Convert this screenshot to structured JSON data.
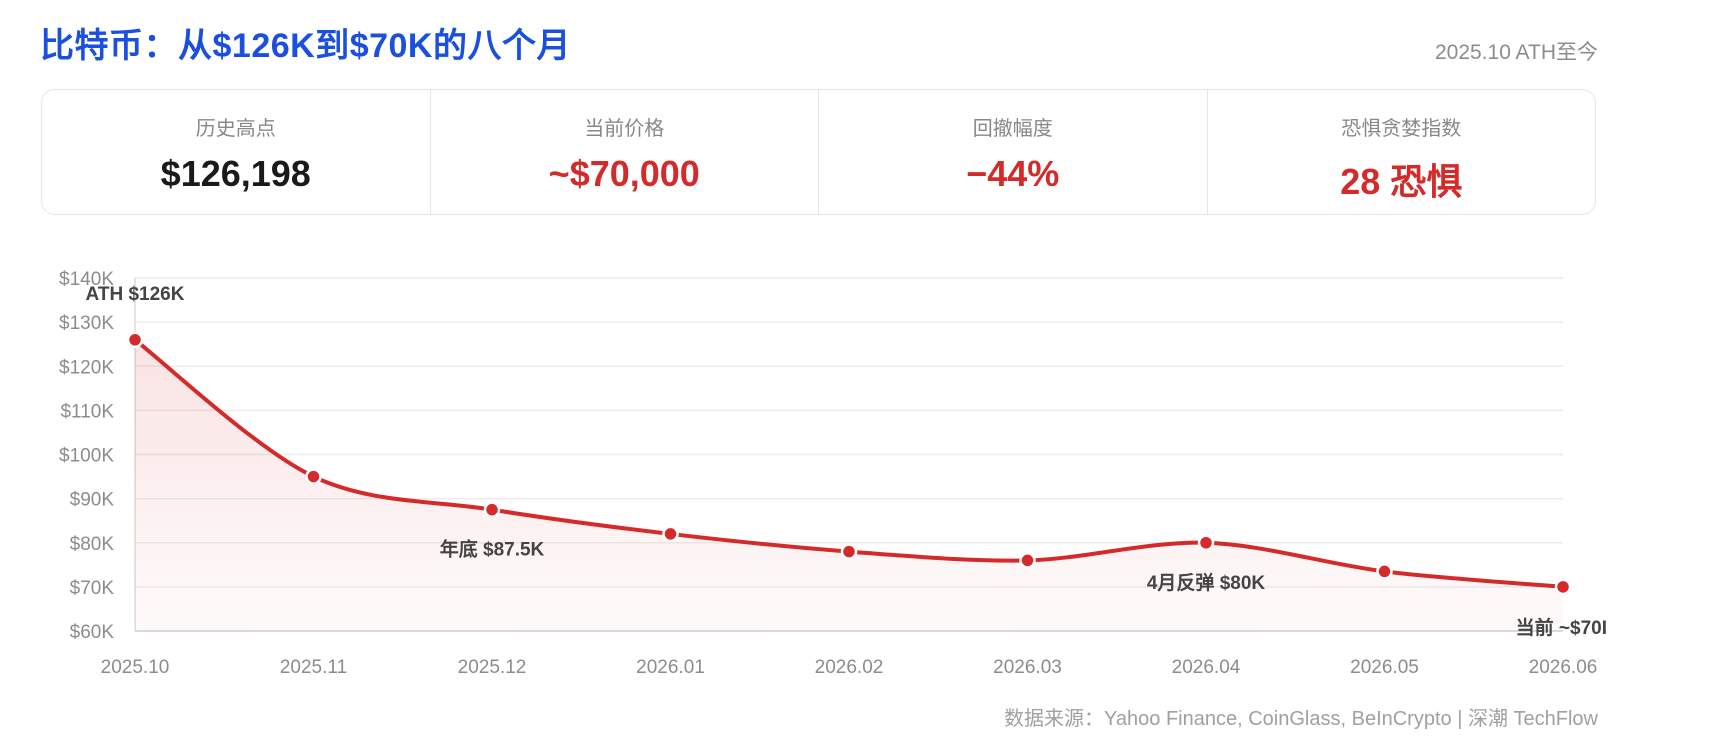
{
  "header": {
    "title": "比特币：从$126K到$70K的八个月",
    "date_range": "2025.10 ATH至今"
  },
  "stats": [
    {
      "label": "历史高点",
      "value": "$126,198",
      "highlight": false
    },
    {
      "label": "当前价格",
      "value": "~$70,000",
      "highlight": true
    },
    {
      "label": "回撤幅度",
      "value": "−44%",
      "highlight": true
    },
    {
      "label": "恐惧贪婪指数",
      "value": "28 恐惧",
      "highlight": true
    }
  ],
  "colors": {
    "title": "#1a4fe0",
    "line": "#d42a2a",
    "accent_red": "#d42a2a"
  },
  "chart_data": {
    "type": "area",
    "categories": [
      "2025.10",
      "2025.11",
      "2025.12",
      "2026.01",
      "2026.02",
      "2026.03",
      "2026.04",
      "2026.05",
      "2026.06"
    ],
    "series": [
      {
        "values": [
          126,
          95,
          87.5,
          82,
          78,
          76,
          80,
          73.5,
          70
        ]
      }
    ],
    "ylim": [
      60,
      140
    ],
    "y_ticks": [
      60,
      70,
      80,
      90,
      100,
      110,
      120,
      130,
      140
    ],
    "y_tick_labels": [
      "$60K",
      "$70K",
      "$80K",
      "$90K",
      "$100K",
      "$110K",
      "$120K",
      "$130K",
      "$140K"
    ],
    "grid": true,
    "annotations": [
      {
        "index": 0,
        "text": "ATH $126K"
      },
      {
        "index": 2,
        "text": "年底 $87.5K"
      },
      {
        "index": 6,
        "text": "4月反弹 $80K"
      },
      {
        "index": 8,
        "text": "当前 ~$70I"
      }
    ]
  },
  "footer": {
    "source": "数据来源：Yahoo Finance, CoinGlass, BeInCrypto | 深潮 TechFlow"
  }
}
